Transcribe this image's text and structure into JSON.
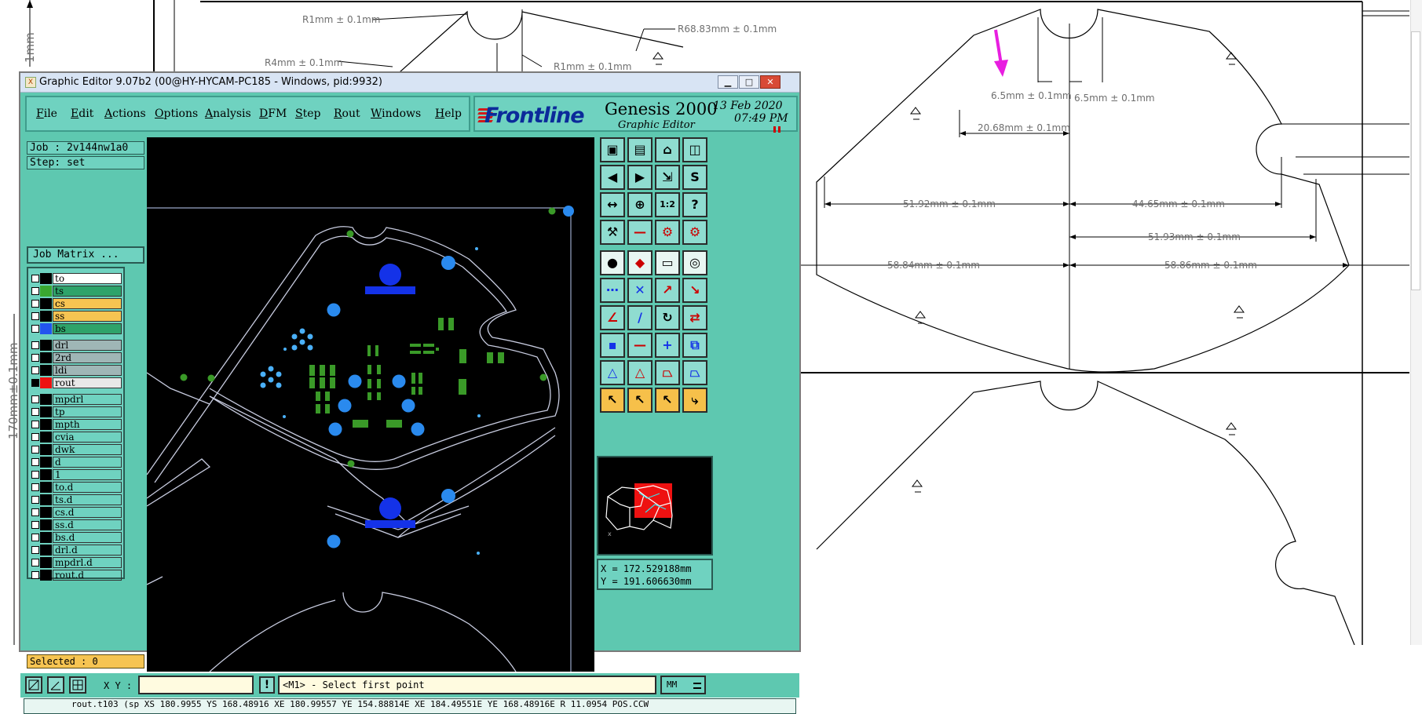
{
  "drawing": {
    "left_rule_top": "1mm",
    "left_rule_bottom": "170mm±0.1mm",
    "dims": {
      "r1_left": "R1mm ± 0.1mm",
      "r4": "R4mm ± 0.1mm",
      "r1_mid": "R1mm ± 0.1mm",
      "r68": "R68.83mm ± 0.1mm",
      "d65_left": "6.5mm ± 0.1mm",
      "d65_right": "6.5mm ± 0.1mm",
      "d2068": "20.68mm ± 0.1mm",
      "d5192": "51.92mm ± 0.1mm",
      "d4465": "44.65mm ± 0.1mm",
      "d5193": "51.93mm ± 0.1mm",
      "d5884": "58.84mm ± 0.1mm",
      "d5886": "58.86mm ± 0.1mm"
    },
    "arrow_color": "#e81ee0"
  },
  "window": {
    "title": "Graphic Editor 9.07b2 (00@HY-HYCAM-PC185 - Windows, pid:9932)",
    "controls": {
      "minimize": "_",
      "restore": "□",
      "close": "X"
    }
  },
  "menu": [
    "File",
    "Edit",
    "Actions",
    "Options",
    "Analysis",
    "DFM",
    "Step",
    "Rout",
    "Windows",
    "Help"
  ],
  "brand": {
    "logo": "Frontline",
    "product": "Genesis 2000",
    "subtitle": "Graphic Editor",
    "date": "13 Feb 2020",
    "time": "07:49 PM"
  },
  "job": {
    "job_line": "Job : 2v144nw1a0",
    "step_line": "Step: set",
    "matrix_button": "Job Matrix ..."
  },
  "layers": [
    {
      "name": "to",
      "swatch": "#000000",
      "bg": "#ffffff"
    },
    {
      "name": "ts",
      "swatch": "#3aa830",
      "bg": "#2ea36a"
    },
    {
      "name": "cs",
      "swatch": "#000000",
      "bg": "#f6c452"
    },
    {
      "name": "ss",
      "swatch": "#000000",
      "bg": "#f6c452"
    },
    {
      "name": "bs",
      "swatch": "#2255ee",
      "bg": "#2ea36a"
    },
    {
      "name": "drl",
      "swatch": "#000000",
      "bg": "#9fb6b6"
    },
    {
      "name": "2rd",
      "swatch": "#000000",
      "bg": "#9fb6b6"
    },
    {
      "name": "ldi",
      "swatch": "#000000",
      "bg": "#9fb6b6"
    },
    {
      "name": "rout",
      "swatch": "#ee1111",
      "bg": "#e8e8e8"
    },
    {
      "name": "mpdrl",
      "swatch": "#000000",
      "bg": "#6fd2c0"
    },
    {
      "name": "tp",
      "swatch": "#000000",
      "bg": "#6fd2c0"
    },
    {
      "name": "mpth",
      "swatch": "#000000",
      "bg": "#6fd2c0"
    },
    {
      "name": "cvia",
      "swatch": "#000000",
      "bg": "#6fd2c0"
    },
    {
      "name": "dwk",
      "swatch": "#000000",
      "bg": "#6fd2c0"
    },
    {
      "name": "d",
      "swatch": "#000000",
      "bg": "#6fd2c0"
    },
    {
      "name": "1",
      "swatch": "#000000",
      "bg": "#6fd2c0"
    },
    {
      "name": "to.d",
      "swatch": "#000000",
      "bg": "#6fd2c0"
    },
    {
      "name": "ts.d",
      "swatch": "#000000",
      "bg": "#6fd2c0"
    },
    {
      "name": "cs.d",
      "swatch": "#000000",
      "bg": "#6fd2c0"
    },
    {
      "name": "ss.d",
      "swatch": "#000000",
      "bg": "#6fd2c0"
    },
    {
      "name": "bs.d",
      "swatch": "#000000",
      "bg": "#6fd2c0"
    },
    {
      "name": "drl.d",
      "swatch": "#000000",
      "bg": "#6fd2c0"
    },
    {
      "name": "mpdrl.d",
      "swatch": "#000000",
      "bg": "#6fd2c0"
    },
    {
      "name": "rout.d",
      "swatch": "#000000",
      "bg": "#6fd2c0"
    }
  ],
  "selected": "Selected : 0",
  "coords": {
    "x": "X = 172.529188mm",
    "y": "Y = 191.606630mm"
  },
  "toolbar": {
    "tools": [
      "home-view-icon",
      "zoom-home-icon",
      "home-icon",
      "window-icon",
      "pan-left-icon",
      "pan-right-icon",
      "zoom-fit-icon",
      "s-icon",
      "zoom-expand-icon",
      "zoom-in-icon",
      "one-to-two-icon",
      "help-icon",
      "measure-tool-icon",
      "separator-icon",
      "settings-red-icon",
      "settings-red-icon-2",
      "select-point-icon",
      "draw-shape-icon",
      "ruler-icon",
      "snap-icon",
      "connect-icon",
      "delete-x-icon",
      "move-icon",
      "link-icon",
      "angle-icon",
      "slash-icon",
      "rotate-icon",
      "mirror-icon",
      "node-icon",
      "line-icon",
      "cross-icon",
      "copy-icon",
      "triangle-icon",
      "triangle-red-icon",
      "trapezoid-icon",
      "trapezoid-arrow-icon",
      "pointer-icon",
      "pointer-red-icon",
      "pointer-box-icon",
      "route-icon"
    ]
  },
  "bottom": {
    "xy_label": "X Y :",
    "xy_value": "",
    "excl": "!",
    "prompt": "<M1> - Select first point",
    "units": "MM"
  },
  "status_line": "rout.t103 (sp XS 180.9955 YS 168.48916 XE 180.99557 YE 154.88814E XE 184.49551E YE 168.48916E R 11.0954 POS.CCW"
}
